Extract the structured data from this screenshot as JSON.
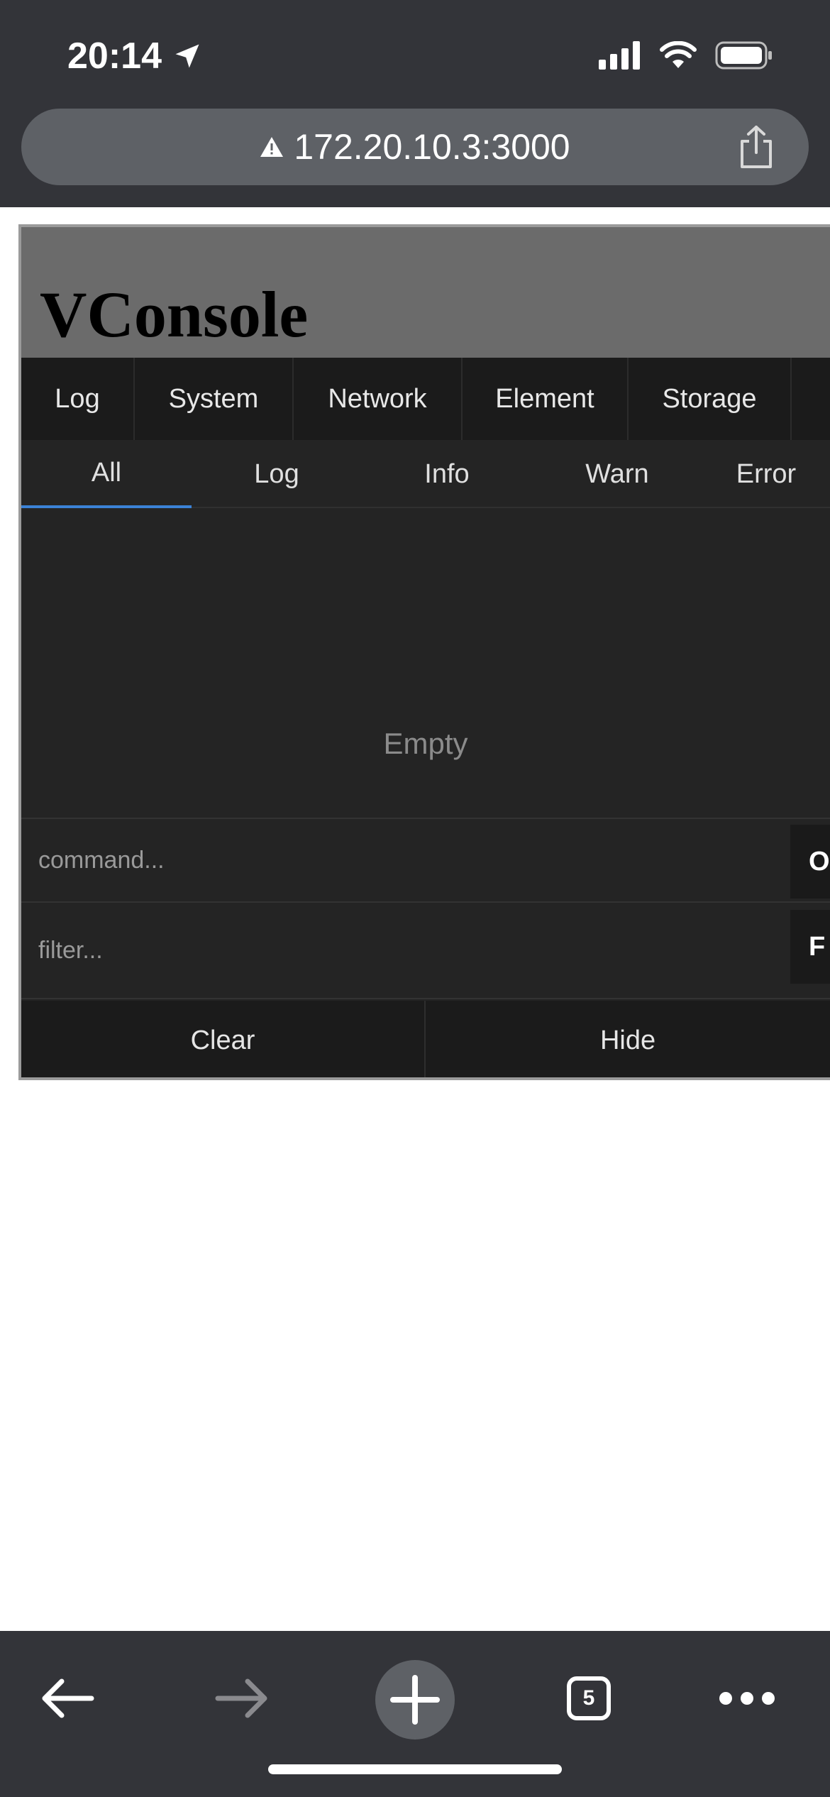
{
  "status_bar": {
    "time": "20:14"
  },
  "browser": {
    "url": "172.20.10.3:3000"
  },
  "vconsole": {
    "title": "VConsole",
    "tabs": [
      {
        "label": "Log"
      },
      {
        "label": "System"
      },
      {
        "label": "Network"
      },
      {
        "label": "Element"
      },
      {
        "label": "Storage"
      }
    ],
    "subtabs": [
      {
        "label": "All"
      },
      {
        "label": "Log"
      },
      {
        "label": "Info"
      },
      {
        "label": "Warn"
      },
      {
        "label": "Error"
      }
    ],
    "empty_text": "Empty",
    "command": {
      "placeholder": "command...",
      "button_label": "O"
    },
    "filter": {
      "placeholder": "filter...",
      "button_label": "F"
    },
    "footer": {
      "clear_label": "Clear",
      "hide_label": "Hide"
    }
  },
  "toolbar": {
    "tab_count": "5"
  }
}
